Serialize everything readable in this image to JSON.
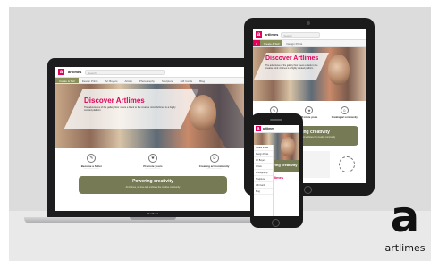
{
  "site": {
    "brand": "artlimes",
    "logo_letter": "a",
    "search_placeholder": "Search",
    "hero_title": "Discover Artlimes",
    "hero_text": "The adventures of the gallery floor meets a blank to the creative mind. Artlimes is a highly curated platform",
    "features": [
      {
        "title": "Become a Seller",
        "icon": "seller-icon"
      },
      {
        "title": "Promote yours",
        "icon": "promote-icon"
      },
      {
        "title": "Creating art community",
        "icon": "community-icon"
      }
    ],
    "powering_title": "Powering creativity",
    "powering_text": "At Artlimes, we love and embrace the creative community",
    "menu_items": [
      "Create & Sell",
      "Design Prints",
      "Art Buyers",
      "Artists",
      "Photography",
      "Sculpture",
      "Gift Cards",
      "Blog"
    ],
    "phone_band_title": "ering creativity",
    "phone_band2_title": "rtlimes"
  },
  "laptop_label": "MacBook",
  "corner": {
    "letter": "a",
    "word": "artlimes"
  },
  "colors": {
    "accent": "#e2005a",
    "olive": "#767b56",
    "backdrop": "#dcdcdc"
  }
}
